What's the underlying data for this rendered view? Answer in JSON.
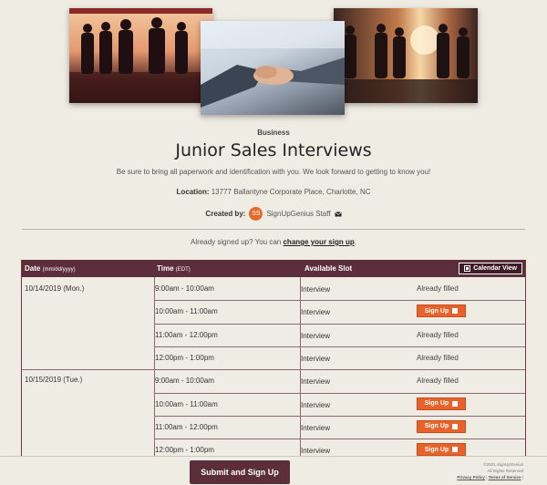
{
  "header": {
    "category": "Business",
    "title": "Junior Sales Interviews",
    "description": "Be sure to bring all paperwork and identification with you. We look forward to getting to know you!",
    "location_label": "Location:",
    "location_value": "13777 Ballantyne Corporate Place, Charlotte, NC",
    "created_by_label": "Created by:",
    "avatar_initials": "SS",
    "created_by_name": "SignUpGenius Staff"
  },
  "already_signed": {
    "text": "Already signed up? You can",
    "link": "change your sign up",
    "suffix": "."
  },
  "table": {
    "col_date": "Date",
    "col_date_hint": "(mm/dd/yyyy)",
    "col_time": "Time",
    "col_time_hint": "(EDT)",
    "col_slot": "Available Slot",
    "calendar_view": "Calendar View",
    "dates": [
      {
        "date": "10/14/2019 (Mon.)"
      },
      {
        "date": "10/15/2019 (Tue.)"
      }
    ],
    "rows": [
      {
        "time": "9:00am - 10:00am",
        "slot": "Interview",
        "status": "Already filled"
      },
      {
        "time": "10:00am - 11:00am",
        "slot": "Interview",
        "status": "Sign Up"
      },
      {
        "time": "11:00am - 12:00pm",
        "slot": "Interview",
        "status": "Already filled"
      },
      {
        "time": "12:00pm - 1:00pm",
        "slot": "Interview",
        "status": "Already filled"
      },
      {
        "time": "9:00am - 10:00am",
        "slot": "Interview",
        "status": "Already filled"
      },
      {
        "time": "10:00am - 11:00am",
        "slot": "Interview",
        "status": "Sign Up"
      },
      {
        "time": "11:00am - 12:00pm",
        "slot": "Interview",
        "status": "Sign Up"
      },
      {
        "time": "12:00pm - 1:00pm",
        "slot": "Interview",
        "status": "Sign Up"
      }
    ]
  },
  "footer": {
    "submit": "Submit and Sign Up",
    "copyright": "©2021 SignUpGenius",
    "rights": "All Rights Reserved",
    "privacy": "Privacy Policy",
    "separator": "|",
    "terms": "Terms of Service",
    "trail": "|"
  },
  "colors": {
    "brand": "#5c2d3b",
    "accent": "#e8632b",
    "background": "#efece3"
  },
  "icons": {
    "mail": "envelope-icon",
    "calendar": "calendar-icon",
    "checkbox": "checkbox-icon"
  }
}
